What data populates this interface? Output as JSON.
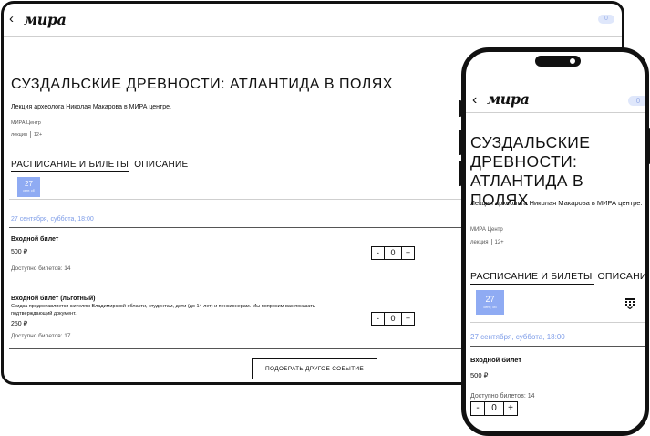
{
  "brand": {
    "logo_text": "мира",
    "back_glyph": "‹"
  },
  "cart": {
    "count": "0"
  },
  "event": {
    "title": "СУЗДАЛЬСКИЕ ДРЕВНОСТИ: АТЛАНТИДА В ПОЛЯХ",
    "subtitle": "Лекция археолога Николая Макарова в МИРА центре.",
    "venue": "МИРА Центр",
    "type": "лекция",
    "age": "12+"
  },
  "tabs": [
    {
      "label": "РАСПИСАНИЕ И БИЛЕТЫ",
      "active": true
    },
    {
      "label": "ОПИСАНИЕ",
      "active": false
    }
  ],
  "date_chip": {
    "day": "27",
    "weekday": "сент, сб"
  },
  "session_date": "27 сентября, суббота, 18:00",
  "tickets": [
    {
      "name": "Входной билет",
      "description": "",
      "price": "500 ₽",
      "availability": "Доступно билетов: 14",
      "quantity": "0"
    },
    {
      "name": "Входной билет (льготный)",
      "description": "Скидка предоставляется жителям Владимирской области, студентам, дети (до 14 лет) и пенсионерам. Мы попросим вас показать подтверждающий документ.",
      "price": "250 ₽",
      "availability": "Доступно билетов: 17",
      "quantity": "0"
    }
  ],
  "stepper": {
    "minus": "-",
    "plus": "+"
  },
  "more_events_button": "ПОДОБРАТЬ ДРУГОЕ СОБЫТИЕ",
  "icons": [
    "back-chevron-icon",
    "calendar-icon",
    "camera-icon"
  ],
  "colors": {
    "accent": "#8fabf3",
    "date_text": "#7d9ce8",
    "cart_bg": "#dfe7fb"
  }
}
